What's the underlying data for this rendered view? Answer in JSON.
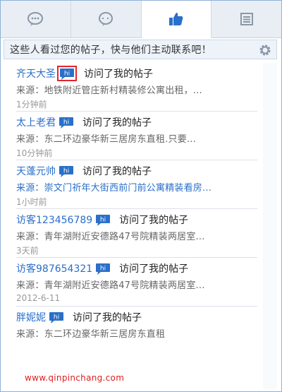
{
  "tabs": [
    {
      "icon": "chat-bubble-icon",
      "active": false
    },
    {
      "icon": "comment-icon",
      "active": false
    },
    {
      "icon": "thumbs-up-icon",
      "active": true
    },
    {
      "icon": "list-icon",
      "active": false
    }
  ],
  "notice": {
    "text": "这些人看过您的帖子，快与他们主动联系吧！",
    "settings_icon": "gear-icon"
  },
  "items": [
    {
      "name": "齐天大圣",
      "hi_icon": "hi-chat-icon",
      "action": "访问了我的帖子",
      "source": "来源：地铁附近管庄新村精装修公寓出租，...",
      "time": "1分钟前",
      "highlight": true,
      "source_blue": false
    },
    {
      "name": "太上老君",
      "hi_icon": "hi-chat-icon",
      "action": "访问了我的帖子",
      "source": "来源：东二环边豪华新三居房东直租.只要...",
      "time": "10分钟前",
      "highlight": false,
      "source_blue": false
    },
    {
      "name": "天蓬元帅",
      "hi_icon": "hi-chat-icon",
      "action": "访问了我的帖子",
      "source": "来源：崇文门祈年大街西前门前公寓精装看房...",
      "time": "1小时前",
      "highlight": false,
      "source_blue": true
    },
    {
      "name": "访客123456789",
      "hi_icon": "hi-chat-icon",
      "action": "访问了我的帖子",
      "source": "来源：青年湖附近安德路47号院精装两居室...",
      "time": "3天前",
      "highlight": false,
      "source_blue": false
    },
    {
      "name": "访客987654321",
      "hi_icon": "hi-chat-icon",
      "action": "访问了我的帖子",
      "source": "来源：青年湖附近安德路47号院精装两居室...",
      "time": "2012-6-11",
      "highlight": false,
      "source_blue": false
    },
    {
      "name": "胖妮妮",
      "hi_icon": "hi-chat-icon",
      "action": "访问了我的帖子",
      "source": "来源：东二环边豪华新三居房东直租",
      "time": "",
      "highlight": false,
      "source_blue": false
    }
  ],
  "watermark": "www.qinpinchang.com",
  "colors": {
    "link": "#2a6fc9",
    "accent": "#2a6fc9",
    "border": "#8fb1d8",
    "highlight": "#e4252b"
  }
}
